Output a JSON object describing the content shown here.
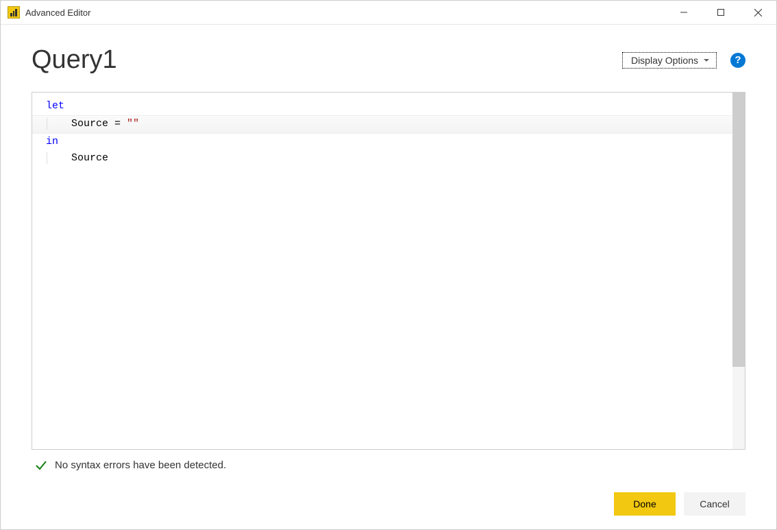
{
  "window": {
    "title": "Advanced Editor"
  },
  "header": {
    "query_name": "Query1",
    "display_options_label": "Display Options"
  },
  "editor": {
    "lines": [
      {
        "type": "keyword",
        "text": "let"
      },
      {
        "type": "source_assign",
        "indent": true,
        "highlighted": true,
        "ident": "Source",
        "op": " = ",
        "string": "\"\""
      },
      {
        "type": "keyword",
        "text": "in"
      },
      {
        "type": "plain",
        "indent": true,
        "text": "Source"
      }
    ]
  },
  "status": {
    "message": "No syntax errors have been detected."
  },
  "footer": {
    "done_label": "Done",
    "cancel_label": "Cancel"
  }
}
